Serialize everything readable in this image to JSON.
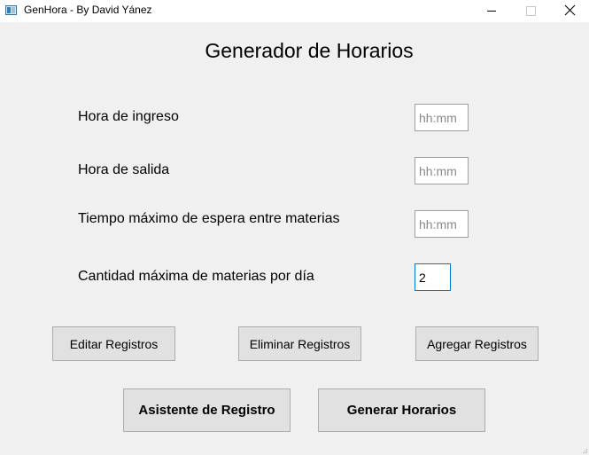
{
  "window": {
    "title": "GenHora - By David Yánez"
  },
  "main": {
    "heading": "Generador de Horarios"
  },
  "form": {
    "entry_label": "Hora de ingreso",
    "entry_placeholder": "hh:mm",
    "exit_label": "Hora de salida",
    "exit_placeholder": "hh:mm",
    "wait_label": "Tiempo máximo de espera entre materias",
    "wait_placeholder": "hh:mm",
    "max_subjects_label": "Cantidad máxima de materias por día",
    "max_subjects_value": "2"
  },
  "actions": {
    "edit_label": "Editar Registros",
    "delete_label": "Eliminar Registros",
    "add_label": "Agregar Registros",
    "wizard_label": "Asistente de Registro",
    "generate_label": "Generar Horarios"
  },
  "icons": {
    "app": "app-icon",
    "minimize": "minimize-icon",
    "maximize": "maximize-icon",
    "close": "close-icon",
    "resize": "resize-grip-icon"
  },
  "colors": {
    "window_bg": "#f0f0f0",
    "button_bg": "#e1e1e1",
    "button_border": "#adadad",
    "focus_border": "#0078d7"
  }
}
